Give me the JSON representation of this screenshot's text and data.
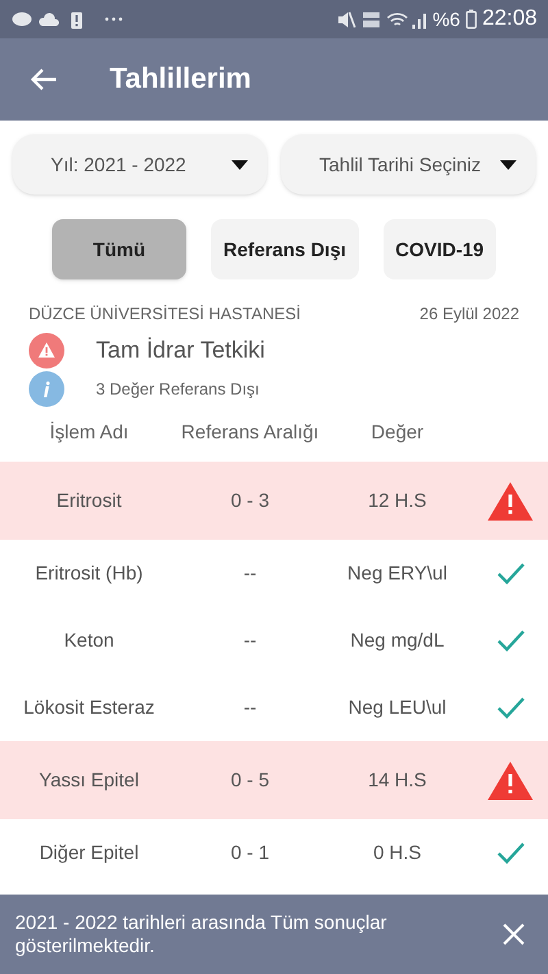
{
  "status_bar": {
    "battery_text": "%6",
    "time": "22:08"
  },
  "app_bar": {
    "title": "Tahlillerim"
  },
  "dropdowns": [
    {
      "value": "Yıl: 2021 - 2022"
    },
    {
      "value": "Tahlil Tarihi Seçiniz"
    }
  ],
  "filters": [
    {
      "label": "Tümü",
      "selected": true
    },
    {
      "label": "Referans Dışı",
      "selected": false
    },
    {
      "label": "COVID-19",
      "selected": false
    }
  ],
  "report": {
    "hospital": "DÜZCE ÜNİVERSİTESİ HASTANESİ",
    "date": "26 Eylül 2022",
    "title": "Tam İdrar Tetkiki",
    "summary": "3 Değer Referans Dışı"
  },
  "table": {
    "columns": [
      "İşlem Adı",
      "Referans Aralığı",
      "Değer"
    ],
    "rows": [
      {
        "name": "Eritrosit",
        "range": "0 - 3",
        "value": "12 H.S",
        "out_of_range": true
      },
      {
        "name": "Eritrosit (Hb)",
        "range": "--",
        "value": "Neg ERY\\ul",
        "out_of_range": false
      },
      {
        "name": "Keton",
        "range": "--",
        "value": "Neg mg/dL",
        "out_of_range": false
      },
      {
        "name": "Lökosit Esteraz",
        "range": "--",
        "value": "Neg LEU\\ul",
        "out_of_range": false
      },
      {
        "name": "Yassı Epitel",
        "range": "0 - 5",
        "value": "14 H.S",
        "out_of_range": true
      },
      {
        "name": "Diğer Epitel",
        "range": "0 - 1",
        "value": "0 H.S",
        "out_of_range": false
      }
    ]
  },
  "snackbar": {
    "message": "2021 - 2022 tarihleri arasında Tüm sonuçlar gösterilmektedir."
  }
}
